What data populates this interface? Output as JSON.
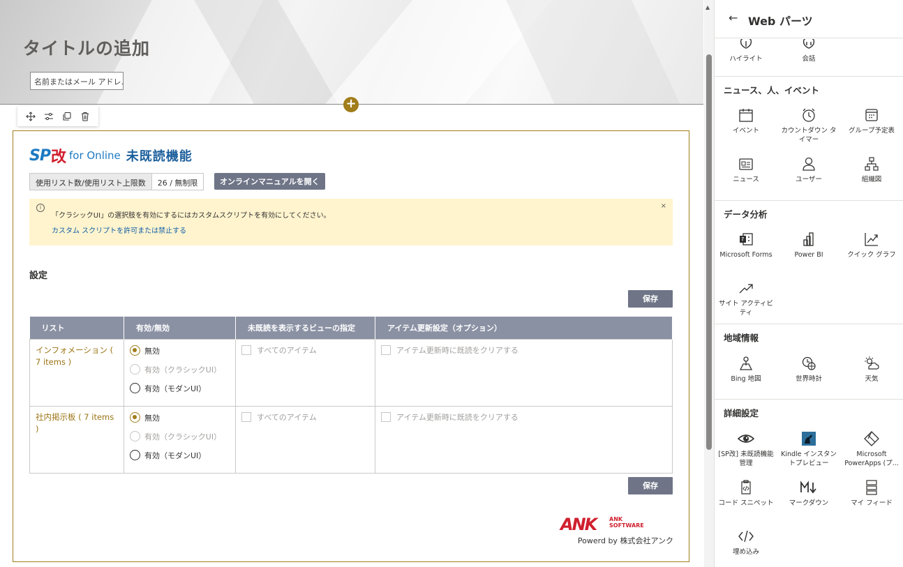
{
  "page": {
    "title": "タイトルの追加",
    "author_placeholder": "名前またはメール アドレ."
  },
  "webpart": {
    "logo": {
      "sp": "SP",
      "kai": "改",
      "for": "for Online",
      "feature": "未既読機能"
    },
    "count_label": "使用リスト数/使用リスト上限数",
    "count_value": "26 / 無制限",
    "manual_button": "オンラインマニュアルを開く",
    "notice": {
      "message": "「クラシックUI」の選択肢を有効にするにはカスタムスクリプトを有効にしてください。",
      "link": "カスタム スクリプトを許可または禁止する",
      "close": "×"
    },
    "settings_title": "設定",
    "save_label": "保存",
    "table": {
      "headers": [
        "リスト",
        "有効/無効",
        "未既読を表示するビューの指定",
        "アイテム更新設定（オプション）"
      ],
      "rows": [
        {
          "list": "インフォメーション ( 7 items )",
          "options": [
            "無効",
            "有効（クラシックUI）",
            "有効（モダンUI）"
          ],
          "selected": 0,
          "view": "すべてのアイテム",
          "update": "アイテム更新時に既読をクリアする"
        },
        {
          "list": "社内掲示板 ( 7 items )",
          "options": [
            "無効",
            "有効（クラシックUI）",
            "有効（モダンUI）"
          ],
          "selected": 0,
          "view": "すべてのアイテム",
          "update": "アイテム更新時に既読をクリアする"
        }
      ]
    },
    "brand": {
      "big": "ANK",
      "small1": "ANK",
      "small2": "SOFTWARE"
    },
    "powered_by": "Powerd by 株式会社アンク"
  },
  "panel": {
    "back": "←",
    "title": "Web パーツ",
    "top_items": [
      "ハイライト",
      "会話"
    ],
    "sections": [
      {
        "title": "ニュース、人、イベント",
        "items": [
          "イベント",
          "カウントダウン タイマー",
          "グループ予定表",
          "ニュース",
          "ユーザー",
          "組織図"
        ]
      },
      {
        "title": "データ分析",
        "items": [
          "Microsoft Forms",
          "Power BI",
          "クイック グラフ",
          "サイト アクティビティ"
        ]
      },
      {
        "title": "地域情報",
        "items": [
          "Bing 地図",
          "世界時計",
          "天気"
        ]
      },
      {
        "title": "詳細設定",
        "items": [
          "[SP改] 未既読機能管理",
          "Kindle インスタントプレビュー",
          "Microsoft PowerApps (プ...",
          "コード スニペット",
          "マークダウン",
          "マイ フィード",
          "埋め込み"
        ]
      }
    ]
  },
  "colors": {
    "accent": "#a17d1b",
    "button": "#6f7587",
    "header": "#8a91a3",
    "notice": "#fff4ce",
    "link": "#0f5ea8"
  }
}
